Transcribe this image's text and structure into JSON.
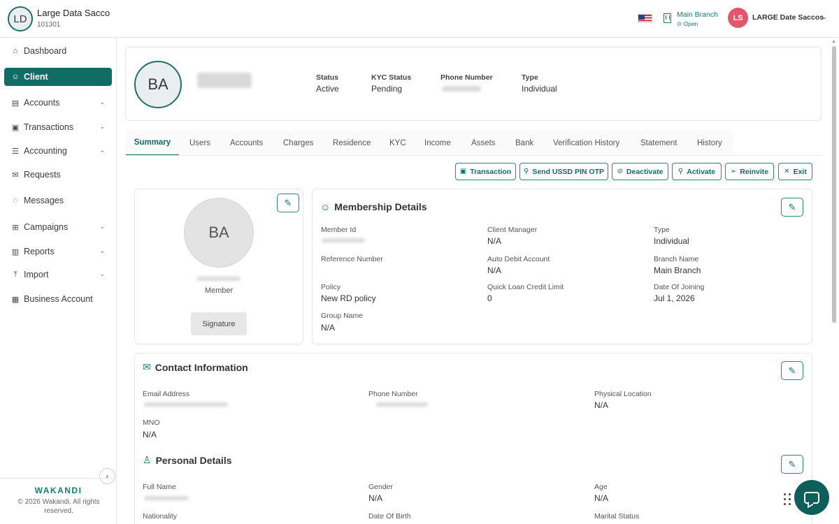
{
  "org": {
    "initials": "LD",
    "name": "Large Data Sacco",
    "code": "101301"
  },
  "topbar": {
    "flag_icon": "us-flag-icon",
    "branch_name": "Main Branch",
    "branch_status": "Open",
    "user_initials": "LS",
    "user_name": "LARGE Date Saccos"
  },
  "sidebar": {
    "items": [
      {
        "label": "Dashboard",
        "icon": "home-icon"
      },
      {
        "label": "Client",
        "icon": "users-icon"
      },
      {
        "label": "Accounts",
        "icon": "wallet-icon"
      },
      {
        "label": "Transactions",
        "icon": "cash-icon"
      },
      {
        "label": "Accounting",
        "icon": "ledger-icon"
      },
      {
        "label": "Requests",
        "icon": "mail-icon"
      },
      {
        "label": "Messages",
        "icon": "chat-icon"
      },
      {
        "label": "Campaigns",
        "icon": "grid-icon"
      },
      {
        "label": "Reports",
        "icon": "bar-chart-icon"
      },
      {
        "label": "Import",
        "icon": "upload-icon"
      },
      {
        "label": "Business Account",
        "icon": "briefcase-icon"
      }
    ],
    "brand": "WAKANDI",
    "copyright": "© 2026 Wakandi. All rights reserved."
  },
  "client_header": {
    "initials": "BA",
    "status_label": "Status",
    "status_value": "Active",
    "kyc_label": "KYC Status",
    "kyc_value": "Pending",
    "phone_label": "Phone Number",
    "type_label": "Type",
    "type_value": "Individual"
  },
  "tabs": [
    "Summary",
    "Users",
    "Accounts",
    "Charges",
    "Residence",
    "KYC",
    "Income",
    "Assets",
    "Bank",
    "Verification History",
    "Statement",
    "History"
  ],
  "actions": [
    "Transaction",
    "Send USSD PIN OTP",
    "Deactivate",
    "Activate",
    "Reinvite",
    "Exit"
  ],
  "profile_card": {
    "initials": "BA",
    "role": "Member",
    "signature_label": "Signature"
  },
  "membership": {
    "title": "Membership Details",
    "member_id_label": "Member Id",
    "client_manager_label": "Client Manager",
    "client_manager_value": "N/A",
    "type_label": "Type",
    "type_value": "Individual",
    "reference_label": "Reference Number",
    "auto_debit_label": "Auto Debit Account",
    "auto_debit_value": "N/A",
    "branch_label": "Branch Name",
    "branch_value": "Main Branch",
    "policy_label": "Policy",
    "policy_value": "New RD policy",
    "quick_loan_label": "Quick Loan Credit Limit",
    "quick_loan_value": "0",
    "joining_label": "Date Of Joining",
    "joining_value": "Jul 1, 2026",
    "group_label": "Group Name",
    "group_value": "N/A"
  },
  "contact": {
    "title": "Contact Information",
    "email_label": "Email Address",
    "phone_label": "Phone Number",
    "location_label": "Physical Location",
    "location_value": "N/A",
    "mno_label": "MNO",
    "mno_value": "N/A"
  },
  "personal": {
    "title": "Personal Details",
    "full_name_label": "Full Name",
    "gender_label": "Gender",
    "gender_value": "N/A",
    "age_label": "Age",
    "age_value": "N/A",
    "nationality_label": "Nationality",
    "dob_label": "Date Of Birth",
    "marital_label": "Marital Status"
  }
}
